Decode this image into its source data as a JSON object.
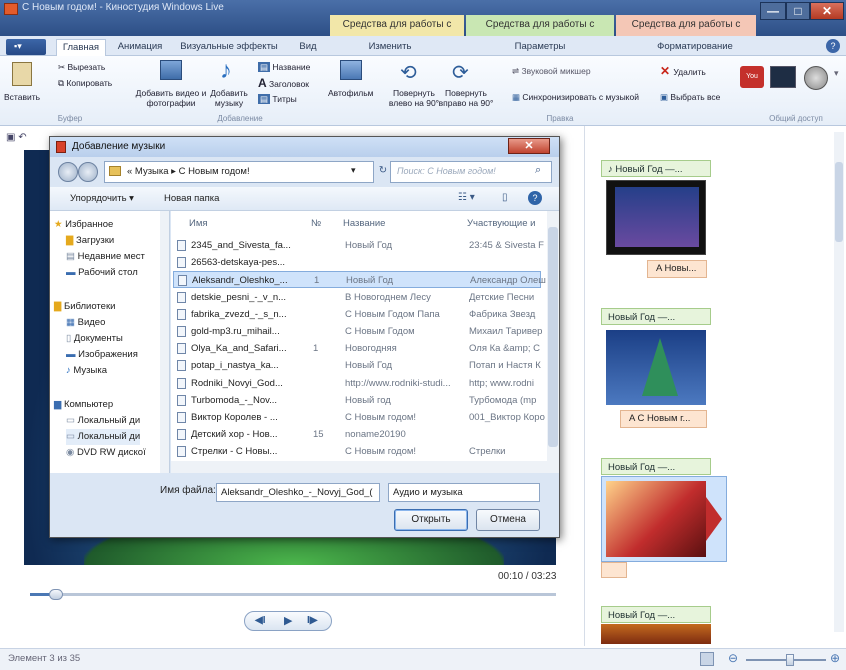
{
  "window": {
    "title": "С Новым годом! - Киностудия Windows Live",
    "context_tabs": [
      "Средства для работы с видео",
      "Средства для работы с музыкой",
      "Средства для работы с текстом"
    ],
    "controls": [
      "—",
      "□",
      "✕"
    ]
  },
  "ribbon": {
    "tabs": [
      "Главная",
      "Анимация",
      "Визуальные эффекты",
      "Вид",
      "Изменить",
      "Параметры",
      "Форматирование"
    ],
    "buttons": {
      "paste": "Вставить",
      "cut": "Вырезать",
      "copy": "Копировать",
      "add_video": "Добавить видео и фотографии",
      "add_music": "Добавить музыку",
      "title": "Название",
      "caption": "Заголовок",
      "credits": "Титры",
      "automovie": "Автофильм",
      "rotate_left": "Повернуть влево на 90°",
      "rotate_right": "Повернуть вправо на 90°",
      "sound_mixer": "Звуковой микшер",
      "sync_music": "Синхронизировать с музыкой",
      "remove": "Удалить",
      "select_all": "Выбрать все"
    },
    "groups": [
      "Буфер",
      "Добавление",
      "Правка",
      "Общий доступ"
    ]
  },
  "dialog": {
    "title": "Добавление музыки",
    "close": "✕",
    "address": "« Музыка ▸ С Новым годом!",
    "search_placeholder": "Поиск: С Новым годом!",
    "organize": "Упорядочить ▾",
    "new_folder": "Новая папка",
    "nav": {
      "favorites": "Избранное",
      "downloads": "Загрузки",
      "recent": "Недавние мест",
      "desktop": "Рабочий стол",
      "libraries": "Библиотеки",
      "video": "Видео",
      "documents": "Документы",
      "images": "Изображения",
      "music": "Музыка",
      "computer": "Компьютер",
      "disk1": "Локальный ди",
      "disk2": "Локальный ди",
      "dvd": "DVD RW дискої"
    },
    "columns": [
      "Имя",
      "№",
      "Название",
      "Участвующие и"
    ],
    "files": [
      {
        "name": "2345_and_Sivesta_fa...",
        "num": "",
        "title": "Новый Год",
        "artist": "23:45 & Sivesta F"
      },
      {
        "name": "26563-detskaya-pes...",
        "num": "",
        "title": "",
        "artist": ""
      },
      {
        "name": "Aleksandr_Oleshko_...",
        "num": "1",
        "title": "Новый Год",
        "artist": "Александр Олеш"
      },
      {
        "name": "detskie_pesni_-_v_n...",
        "num": "",
        "title": "В Новогоднем Лесу",
        "artist": "Детские Песни"
      },
      {
        "name": "fabrika_zvezd_-_s_n...",
        "num": "",
        "title": "С Новым Годом Папа",
        "artist": "Фабрика Звезд"
      },
      {
        "name": "gold-mp3.ru_mihail...",
        "num": "",
        "title": "С Новым Годом",
        "artist": "Михаил Таривер"
      },
      {
        "name": "Olya_Ka_and_Safari...",
        "num": "1",
        "title": "Новогодняя",
        "artist": "Оля Ка &amp; С"
      },
      {
        "name": "potap_i_nastya_ka...",
        "num": "",
        "title": "Новый Год",
        "artist": "Потап и Настя К"
      },
      {
        "name": "Rodniki_Novyi_God...",
        "num": "",
        "title": "http://www.rodniki-studi...",
        "artist": "http; www.rodni"
      },
      {
        "name": "Turbomoda_-_Nov...",
        "num": "",
        "title": "Новый год",
        "artist": "Турбомода (mp"
      },
      {
        "name": "Виктор Королев - ...",
        "num": "",
        "title": "С Новым годом!",
        "artist": "001_Виктор Коро"
      },
      {
        "name": "Детский хор - Нов...",
        "num": "15",
        "title": "noname20190",
        "artist": ""
      },
      {
        "name": "Стрелки - С Новы...",
        "num": "",
        "title": "С Новым годом!",
        "artist": "Стрелки"
      }
    ],
    "filename_label": "Имя файла:",
    "filename_value": "Aleksandr_Oleshko_-_Novyj_God_(",
    "filetype": "Аудио и музыка",
    "open": "Открыть",
    "cancel": "Отмена"
  },
  "player": {
    "time": "00:10 / 03:23",
    "controls": [
      "◀I",
      "▶",
      "I▶"
    ],
    "progress": 0.05
  },
  "timeline": {
    "clips": [
      {
        "label": "♪ Новый Год —..."
      },
      {
        "label": "Новый Год —..."
      },
      {
        "label": "Новый Год —..."
      },
      {
        "label": "Новый Год —..."
      }
    ],
    "captions": [
      "A Новы...",
      "A С Новым г..."
    ]
  },
  "status": {
    "text": "Элемент 3 из 35",
    "zoom": 0.55
  },
  "colors": {
    "ctx_video": "#f2e7a9",
    "ctx_music": "#c9e7b3",
    "ctx_text": "#f4c7b6",
    "accent": "#2d4f86"
  }
}
